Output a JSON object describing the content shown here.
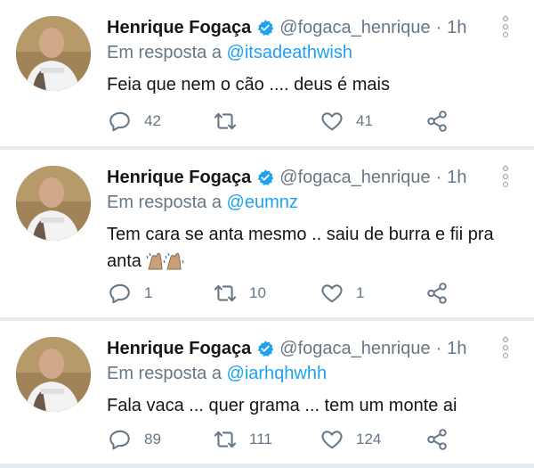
{
  "tweets": [
    {
      "name": "Henrique Fogaça",
      "handle": "@fogaca_henrique",
      "separator": "·",
      "time": "1h",
      "reply_prefix": "Em resposta a",
      "reply_to": "@itsadeathwish",
      "text": "Feia que nem o cão .... deus é mais",
      "replies": "42",
      "retweets": "",
      "likes": "41"
    },
    {
      "name": "Henrique Fogaça",
      "handle": "@fogaca_henrique",
      "separator": "·",
      "time": "1h",
      "reply_prefix": "Em resposta a",
      "reply_to": "@eumnz",
      "text": "Tem cara se anta mesmo .. saiu de burra e fii pra anta",
      "emoji": "clapping-hands-emoji",
      "replies": "1",
      "retweets": "10",
      "likes": "1"
    },
    {
      "name": "Henrique Fogaça",
      "handle": "@fogaca_henrique",
      "separator": "·",
      "time": "1h",
      "reply_prefix": "Em resposta a",
      "reply_to": "@iarhqhwhh",
      "text": "Fala vaca ... quer grama ... tem um monte ai",
      "replies": "89",
      "retweets": "111",
      "likes": "124"
    }
  ],
  "colors": {
    "link": "#1da1f2",
    "secondary": "#657786",
    "verified": "#1da1f2",
    "divider": "#e6ecf0"
  },
  "icons": [
    "verified-badge-icon",
    "more-options-icon",
    "reply-icon",
    "retweet-icon",
    "like-icon",
    "share-icon"
  ]
}
